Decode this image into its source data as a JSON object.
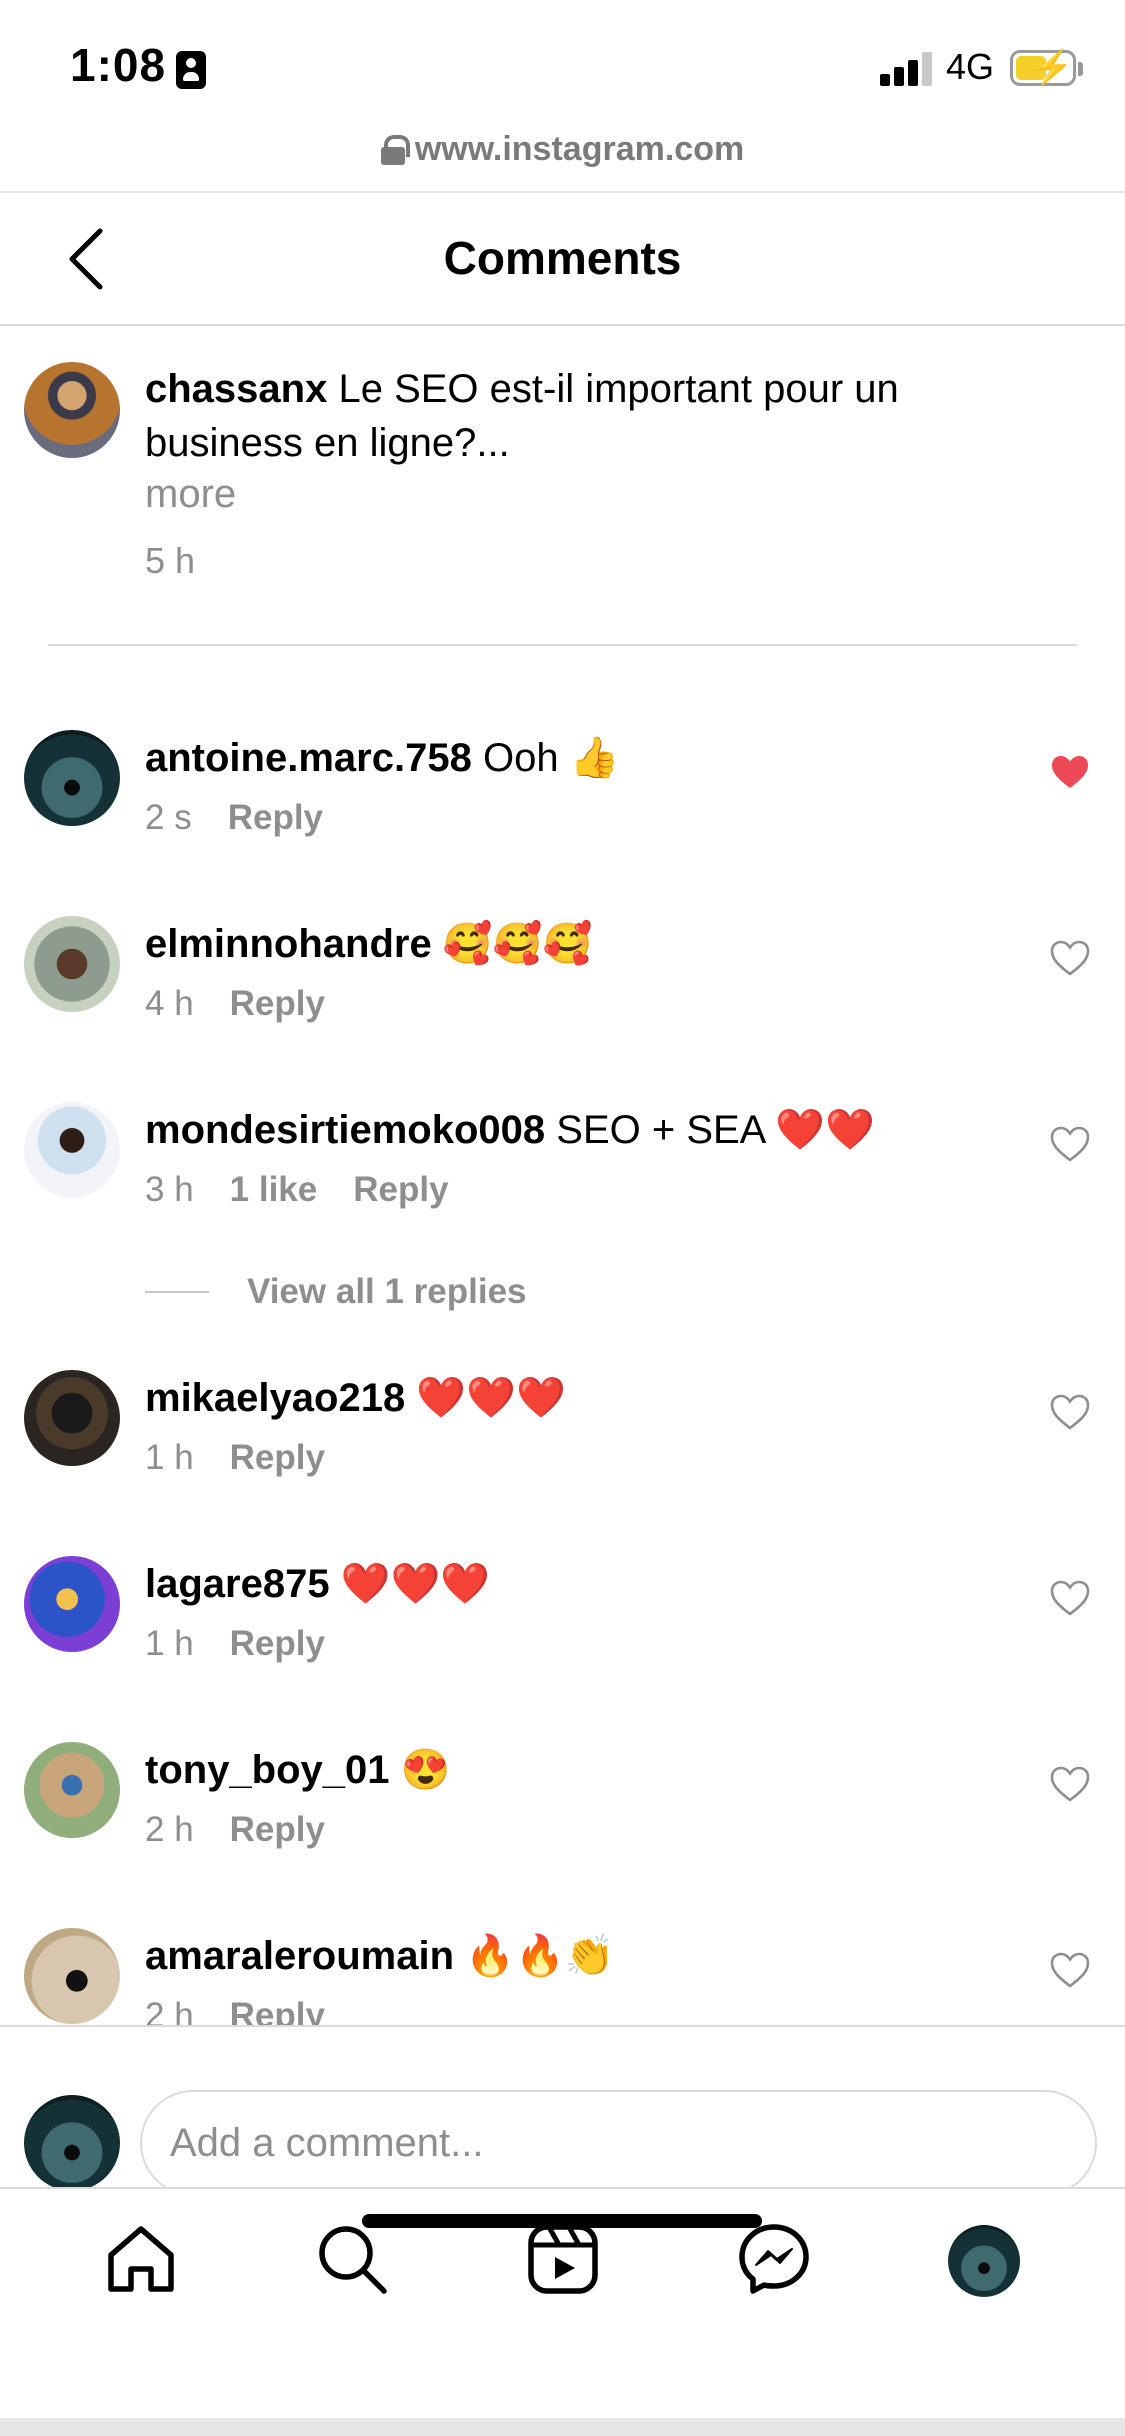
{
  "status_bar": {
    "time": "1:08",
    "network": "4G"
  },
  "url_bar": {
    "url": "www.instagram.com"
  },
  "header": {
    "title": "Comments"
  },
  "caption": {
    "username": "chassanx",
    "text": "Le SEO est-il important pour un business en ligne?...",
    "more_label": "more",
    "time": "5 h"
  },
  "comments": [
    {
      "username": "antoine.marc.758",
      "text": "Ooh 👍",
      "time": "2 s",
      "likes": "",
      "reply_label": "Reply",
      "liked": true
    },
    {
      "username": "elminnohandre",
      "text": "🥰🥰🥰",
      "time": "4 h",
      "likes": "",
      "reply_label": "Reply",
      "liked": false
    },
    {
      "username": "mondesirtiemoko008",
      "text": "SEO + SEA ❤️❤️",
      "time": "3 h",
      "likes": "1 like",
      "reply_label": "Reply",
      "liked": false
    },
    {
      "username": "mikaelyao218",
      "text": "❤️❤️❤️",
      "time": "1 h",
      "likes": "",
      "reply_label": "Reply",
      "liked": false
    },
    {
      "username": "lagare875",
      "text": "❤️❤️❤️",
      "time": "1 h",
      "likes": "",
      "reply_label": "Reply",
      "liked": false
    },
    {
      "username": "tony_boy_01",
      "text": "😍",
      "time": "2 h",
      "likes": "",
      "reply_label": "Reply",
      "liked": false
    },
    {
      "username": "amaraleroumain",
      "text": "🔥🔥👏",
      "time": "2 h",
      "likes": "",
      "reply_label": "Reply",
      "liked": false
    }
  ],
  "view_replies": {
    "label": "View all 1 replies"
  },
  "compose": {
    "placeholder": "Add a comment..."
  },
  "nav": {
    "items": [
      "home-icon",
      "search-icon",
      "reels-icon",
      "messenger-icon",
      "profile-avatar"
    ]
  },
  "colors": {
    "liked_heart": "#ed4956",
    "secondary_text": "#8e8e8e",
    "battery_charge": "#f5d02a"
  }
}
